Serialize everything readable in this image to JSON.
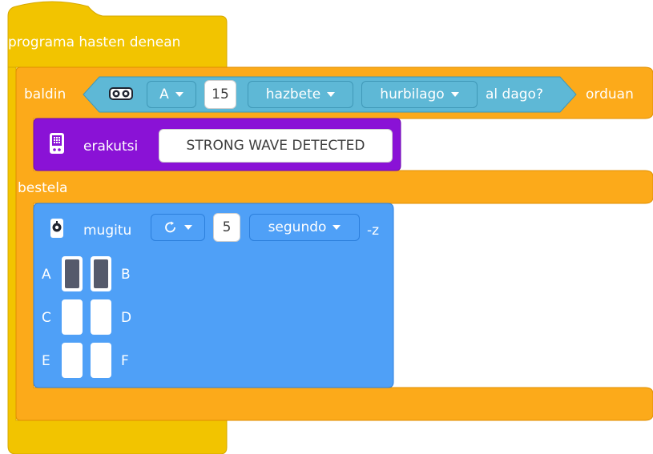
{
  "colors": {
    "event": "#f2c400",
    "control": "#fcaa1a",
    "sensor": "#5eb8d6",
    "display": "#8a12d6",
    "motion": "#4fa0f7"
  },
  "hat": {
    "label": "programa hasten denean"
  },
  "if_block": {
    "if_label": "baldin",
    "then_label": "orduan",
    "else_label": "bestela",
    "condition": {
      "sensor_icon": "ultrasonic-sensor-icon",
      "port": "A",
      "distance": "15",
      "unit": "hazbete",
      "comparison": "hurbilago",
      "suffix": "al dago?"
    }
  },
  "display_block": {
    "icon": "display-matrix-icon",
    "label": "erakutsi",
    "text": "STRONG WAVE DETECTED"
  },
  "move_block": {
    "icon": "motor-icon",
    "label": "mugitu",
    "direction_icon": "rotate-clockwise-icon",
    "amount": "5",
    "unit": "segundo",
    "suffix": "-z",
    "ports": [
      {
        "left": "A",
        "right": "B",
        "left_on": true,
        "right_on": true
      },
      {
        "left": "C",
        "right": "D",
        "left_on": false,
        "right_on": false
      },
      {
        "left": "E",
        "right": "F",
        "left_on": false,
        "right_on": false
      }
    ]
  }
}
